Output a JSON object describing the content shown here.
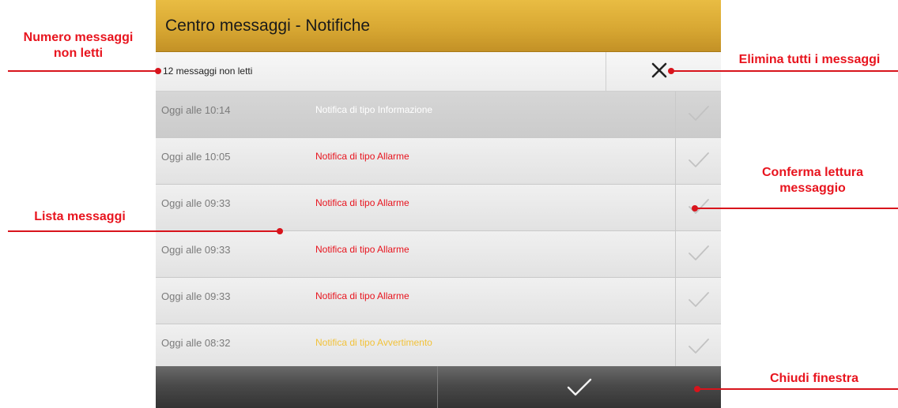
{
  "window": {
    "title": "Centro messaggi - Notifiche"
  },
  "summary": {
    "unread_count_text": "12 messaggi non letti"
  },
  "colors": {
    "accent": "#d8a833",
    "info": "#ffffff",
    "alarm": "#e8141e",
    "warning": "#f2c23a",
    "annotation": "#e8141e"
  },
  "messages": [
    {
      "time": "Oggi alle 10:14",
      "text": "Notifica di tipo Informazione",
      "type": "info"
    },
    {
      "time": "Oggi alle 10:05",
      "text": "Notifica di tipo Allarme",
      "type": "alarm"
    },
    {
      "time": "Oggi alle 09:33",
      "text": "Notifica di tipo Allarme",
      "type": "alarm"
    },
    {
      "time": "Oggi alle 09:33",
      "text": "Notifica di tipo Allarme",
      "type": "alarm"
    },
    {
      "time": "Oggi alle 09:33",
      "text": "Notifica di tipo Allarme",
      "type": "alarm"
    },
    {
      "time": "Oggi alle 08:32",
      "text": "Notifica di tipo Avvertimento",
      "type": "warning"
    }
  ],
  "icons": {
    "delete_all": "close-x-icon",
    "acknowledge": "check-icon",
    "close_window": "check-icon"
  },
  "annotations": {
    "unread_count": "Numero messaggi non letti",
    "delete_all": "Elimina tutti i messaggi",
    "confirm_read": "Conferma lettura messaggio",
    "message_list": "Lista messaggi",
    "close_window": "Chiudi finestra"
  }
}
